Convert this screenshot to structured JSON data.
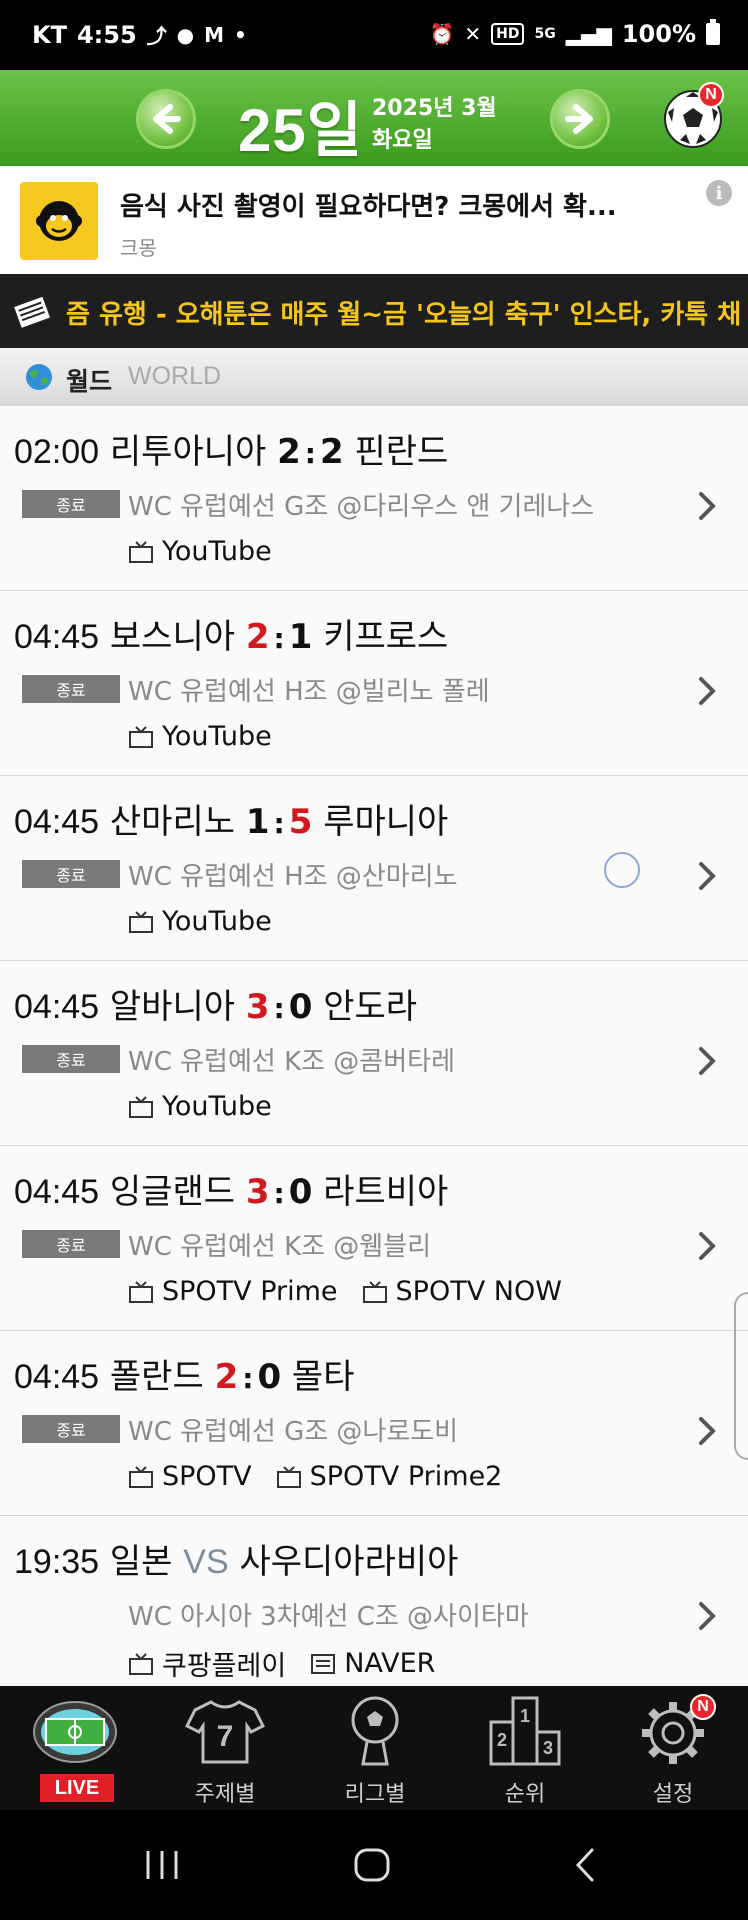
{
  "status_bar": {
    "carrier": "KT",
    "time": "4:55",
    "battery": "100%",
    "hd_badge": "HD",
    "network": "5G"
  },
  "header": {
    "day": "25일",
    "year_month": "2025년 3월",
    "weekday": "화요일",
    "badge": "N",
    "prev_icon": "arrow-left-icon",
    "next_icon": "arrow-right-icon"
  },
  "ad": {
    "title": "음식 사진 촬영이 필요하다면? 크몽에서 확...",
    "advertiser": "크몽",
    "info_glyph": "i"
  },
  "ticker": {
    "text": "즘 유행 - 오해툰은 매주 월~금 '오늘의 축구' 인스타, 카톡 채"
  },
  "section": {
    "label_ko": "월드",
    "label_en": "WORLD"
  },
  "matches": [
    {
      "time": "02:00",
      "home": "리투아니아",
      "home_score": "2",
      "away_score": "2",
      "away": "핀란드",
      "status": "종료",
      "info": "WC 유럽예선 G조 @다리우스 앤 기레나스",
      "broadcast": [
        "YouTube"
      ]
    },
    {
      "time": "04:45",
      "home": "보스니아",
      "home_score": "2",
      "away_score": "1",
      "away": "키프로스",
      "status": "종료",
      "info": "WC 유럽예선 H조 @빌리노 폴레",
      "broadcast": [
        "YouTube"
      ]
    },
    {
      "time": "04:45",
      "home": "산마리노",
      "home_score": "1",
      "away_score": "5",
      "away": "루마니아",
      "status": "종료",
      "info": "WC 유럽예선 H조 @산마리노",
      "broadcast": [
        "YouTube"
      ]
    },
    {
      "time": "04:45",
      "home": "알바니아",
      "home_score": "3",
      "away_score": "0",
      "away": "안도라",
      "status": "종료",
      "info": "WC 유럽예선 K조 @콤버타레",
      "broadcast": [
        "YouTube"
      ]
    },
    {
      "time": "04:45",
      "home": "잉글랜드",
      "home_score": "3",
      "away_score": "0",
      "away": "라트비아",
      "status": "종료",
      "info": "WC 유럽예선 K조 @웸블리",
      "broadcast": [
        "SPOTV Prime",
        "SPOTV NOW"
      ]
    },
    {
      "time": "04:45",
      "home": "폴란드",
      "home_score": "2",
      "away_score": "0",
      "away": "몰타",
      "status": "종료",
      "info": "WC 유럽예선 G조 @나로도비",
      "broadcast": [
        "SPOTV",
        "SPOTV Prime2"
      ]
    },
    {
      "time": "19:35",
      "home": "일본",
      "vs": "VS",
      "away": "사우디아라비아",
      "info": "WC 아시아 3차예선 C조 @사이타마",
      "broadcast": [
        "쿠팡플레이",
        "NAVER"
      ]
    }
  ],
  "bottom_nav": {
    "live": "LIVE",
    "team": "주제별",
    "jersey_number": "7",
    "league": "리그별",
    "rank": "순위",
    "settings": "설정",
    "settings_badge": "N",
    "podium": [
      "2",
      "1",
      "3"
    ]
  },
  "colors": {
    "header_green": "#3a9c1d",
    "win_red": "#d1191f",
    "ticker_yellow": "#f5c518",
    "live_red": "#e21f26"
  }
}
